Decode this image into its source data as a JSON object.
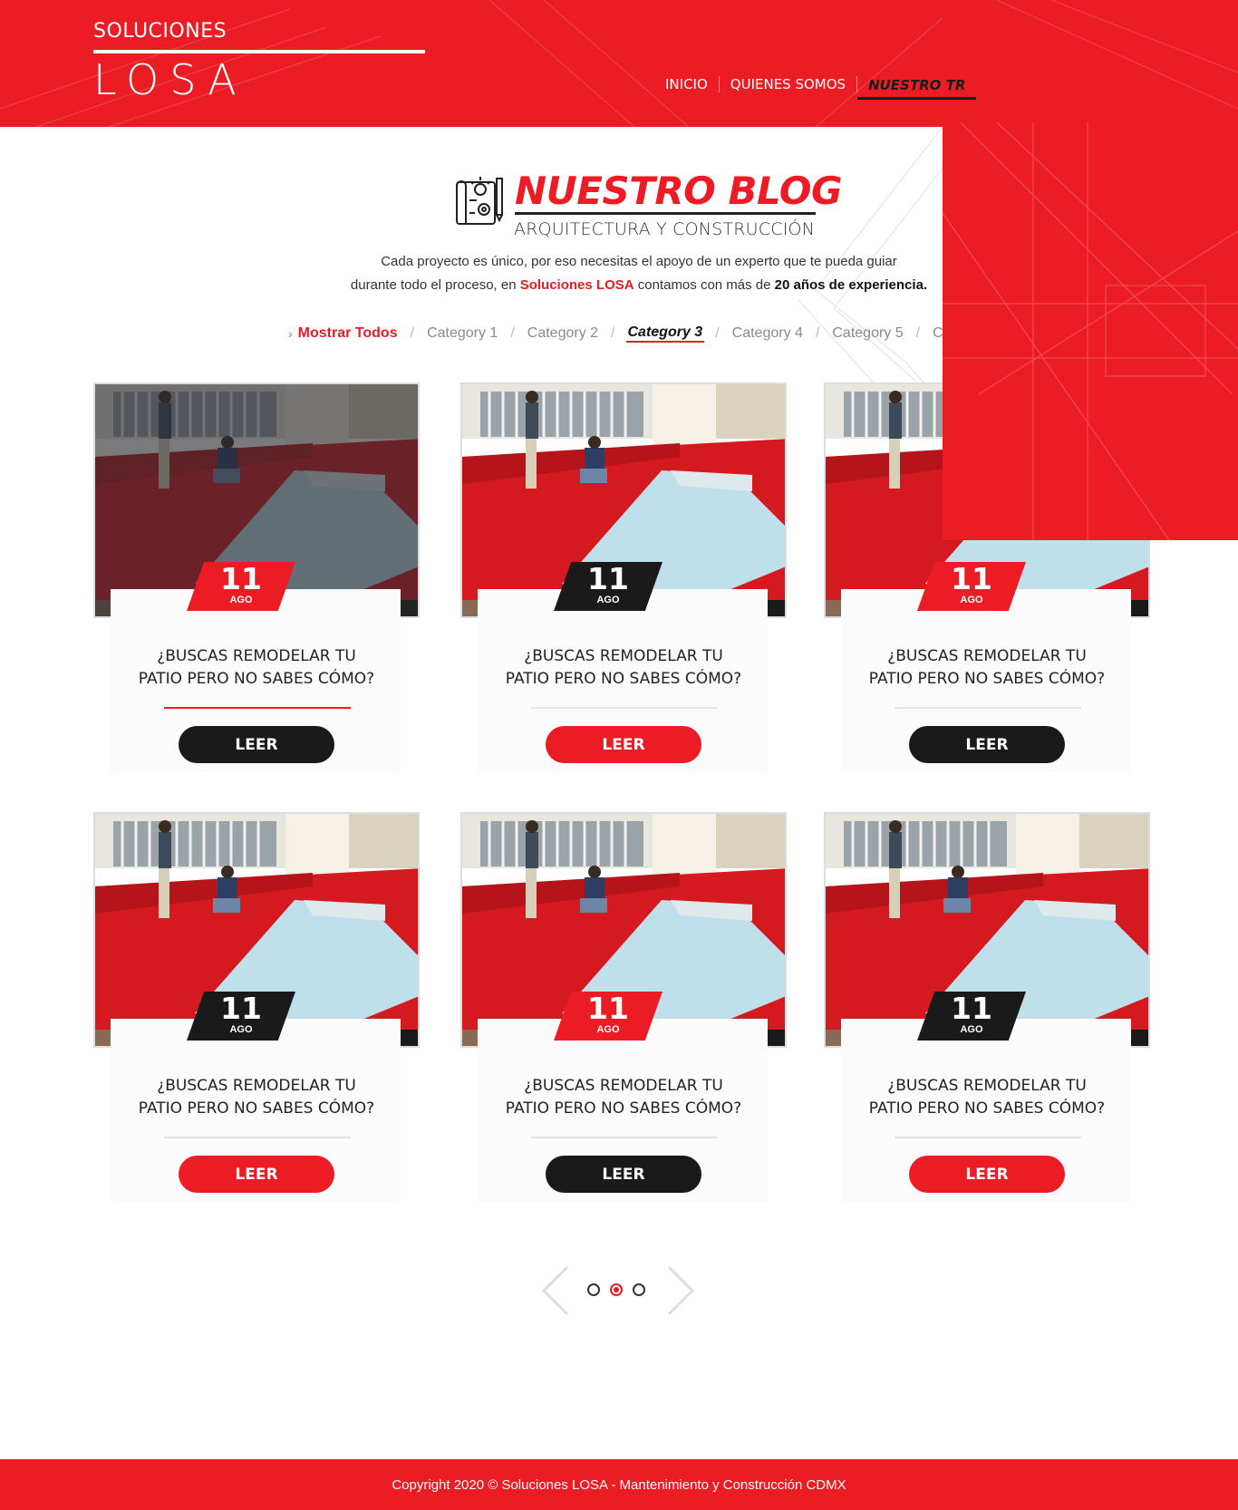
{
  "brand": {
    "top": "SOLUCIONES",
    "main": "LOSA"
  },
  "nav": {
    "items": [
      "INICIO",
      "QUIENES SOMOS",
      "NUESTRO TR"
    ]
  },
  "heading": {
    "title": "NUESTRO BLOG",
    "subtitle": "ARQUITECTURA Y CONSTRUCCIÓN"
  },
  "intro": {
    "line1": "Cada proyecto es único, por eso necesitas el apoyo de un experto que te pueda guiar",
    "line2_a": "durante todo el proceso, en ",
    "brand": "Soluciones LOSA",
    "line2_b": " contamos con más de ",
    "strong": "20 años de experiencia."
  },
  "filters": {
    "all": "Mostrar Todos",
    "items": [
      "Category 1",
      "Category 2",
      "Category 3",
      "Category 4",
      "Category 5",
      "C"
    ],
    "active": "Category 3"
  },
  "cards": [
    {
      "day": "11",
      "month": "AGO",
      "title_l1": "¿BUSCAS REMODELAR TU",
      "title_l2": "PATIO PERO NO SABES CÓMO?",
      "button": "LEER"
    },
    {
      "day": "11",
      "month": "AGO",
      "title_l1": "¿BUSCAS REMODELAR TU",
      "title_l2": "PATIO PERO NO SABES CÓMO?",
      "button": "LEER"
    },
    {
      "day": "11",
      "month": "AGO",
      "title_l1": "¿BUSCAS REMODELAR TU",
      "title_l2": "PATIO PERO NO SABES CÓMO?",
      "button": "LEER"
    },
    {
      "day": "11",
      "month": "AGO",
      "title_l1": "¿BUSCAS REMODELAR TU",
      "title_l2": "PATIO PERO NO SABES CÓMO?",
      "button": "LEER"
    },
    {
      "day": "11",
      "month": "AGO",
      "title_l1": "¿BUSCAS REMODELAR TU",
      "title_l2": "PATIO PERO NO SABES CÓMO?",
      "button": "LEER"
    },
    {
      "day": "11",
      "month": "AGO",
      "title_l1": "¿BUSCAS REMODELAR TU",
      "title_l2": "PATIO PERO NO SABES CÓMO?",
      "button": "LEER"
    }
  ],
  "pagination": {
    "pages": 3,
    "current": 2
  },
  "footer": {
    "text": "Copyright 2020 © Soluciones LOSA - Mantenimiento y Construcción CDMX"
  },
  "colors": {
    "accent": "#ec1c24",
    "dark": "#1a1a1a"
  },
  "icons": {
    "blog": "blueprint-icon",
    "prev": "chevron-left-icon",
    "next": "chevron-right-icon",
    "filter": "chevron-right-icon"
  }
}
